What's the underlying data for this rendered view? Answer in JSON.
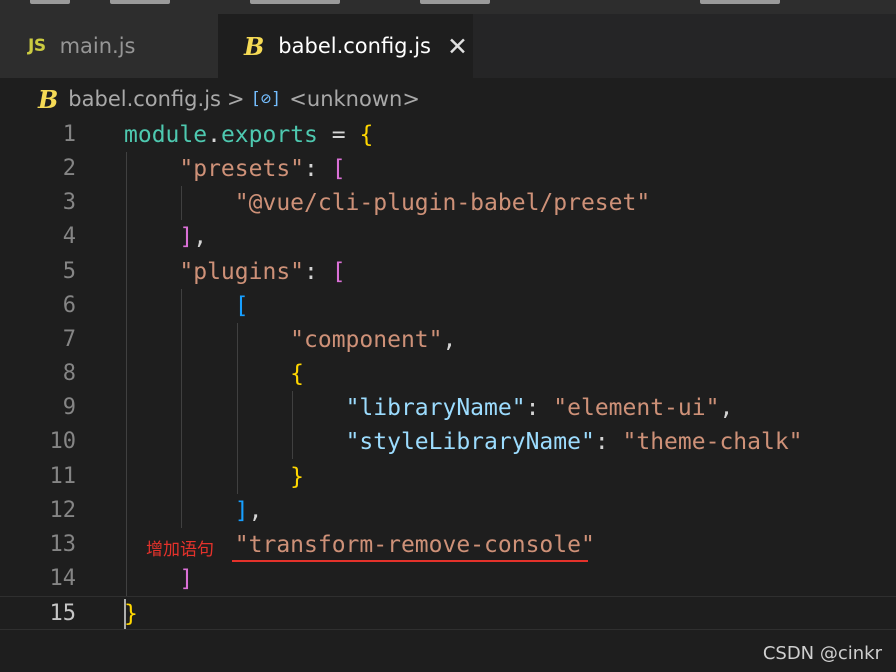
{
  "tabs": [
    {
      "icon": "JS",
      "label": "main.js"
    },
    {
      "icon": "B",
      "label": "babel.config.js",
      "close": "✕"
    }
  ],
  "breadcrumb": {
    "icon": "B",
    "file": "babel.config.js",
    "separator": ">",
    "symbol_icon": "[⊘]",
    "symbol": "<unknown>"
  },
  "code_lines": [
    {
      "num": "1",
      "tokens": [
        {
          "t": "module",
          "c": "var"
        },
        {
          "t": ".",
          "c": "op"
        },
        {
          "t": "exports",
          "c": "var"
        },
        {
          "t": " = ",
          "c": "op"
        },
        {
          "t": "{",
          "c": "b1"
        }
      ]
    },
    {
      "num": "2",
      "tokens": [
        {
          "t": "    "
        },
        {
          "t": "\"presets\"",
          "c": "str"
        },
        {
          "t": ": ",
          "c": "op"
        },
        {
          "t": "[",
          "c": "b2"
        }
      ]
    },
    {
      "num": "3",
      "tokens": [
        {
          "t": "        "
        },
        {
          "t": "\"@vue/cli-plugin-babel/preset\"",
          "c": "str"
        }
      ]
    },
    {
      "num": "4",
      "tokens": [
        {
          "t": "    "
        },
        {
          "t": "]",
          "c": "b2"
        },
        {
          "t": ",",
          "c": "op"
        }
      ]
    },
    {
      "num": "5",
      "tokens": [
        {
          "t": "    "
        },
        {
          "t": "\"plugins\"",
          "c": "str"
        },
        {
          "t": ": ",
          "c": "op"
        },
        {
          "t": "[",
          "c": "b2"
        }
      ]
    },
    {
      "num": "6",
      "tokens": [
        {
          "t": "        "
        },
        {
          "t": "[",
          "c": "b3"
        }
      ]
    },
    {
      "num": "7",
      "tokens": [
        {
          "t": "            "
        },
        {
          "t": "\"component\"",
          "c": "str"
        },
        {
          "t": ",",
          "c": "op"
        }
      ]
    },
    {
      "num": "8",
      "tokens": [
        {
          "t": "            "
        },
        {
          "t": "{",
          "c": "b1"
        }
      ]
    },
    {
      "num": "9",
      "tokens": [
        {
          "t": "                "
        },
        {
          "t": "\"libraryName\"",
          "c": "prop"
        },
        {
          "t": ": ",
          "c": "op"
        },
        {
          "t": "\"element-ui\"",
          "c": "str"
        },
        {
          "t": ",",
          "c": "op"
        }
      ]
    },
    {
      "num": "10",
      "tokens": [
        {
          "t": "                "
        },
        {
          "t": "\"styleLibraryName\"",
          "c": "prop"
        },
        {
          "t": ": ",
          "c": "op"
        },
        {
          "t": "\"theme-chalk\"",
          "c": "str"
        }
      ]
    },
    {
      "num": "11",
      "tokens": [
        {
          "t": "            "
        },
        {
          "t": "}",
          "c": "b1"
        }
      ]
    },
    {
      "num": "12",
      "tokens": [
        {
          "t": "        "
        },
        {
          "t": "]",
          "c": "b3"
        },
        {
          "t": ",",
          "c": "op"
        }
      ]
    },
    {
      "num": "13",
      "tokens": [
        {
          "t": "        "
        },
        {
          "t": "\"transform-remove-console\"",
          "c": "str"
        }
      ]
    },
    {
      "num": "14",
      "tokens": [
        {
          "t": "    "
        },
        {
          "t": "]",
          "c": "b2"
        }
      ]
    },
    {
      "num": "15",
      "tokens": [
        {
          "t": "}",
          "c": "b1"
        }
      ]
    }
  ],
  "annotation": "增加语句",
  "watermark": "CSDN @cinkr",
  "colors": {
    "annotation": "#e5322b",
    "string": "#ce9178",
    "property": "#9cdcfe",
    "variable": "#4ec9b0",
    "bracket_gold": "#ffd700",
    "bracket_pink": "#da70d6",
    "bracket_blue": "#179fff"
  }
}
